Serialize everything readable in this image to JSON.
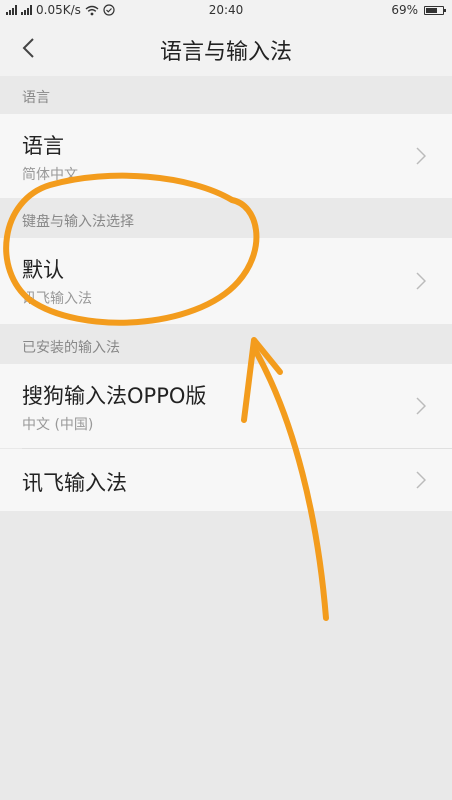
{
  "status_bar": {
    "network_speed": "0.05K/s",
    "time": "20:40",
    "battery": "69%",
    "battery_level": 0.69
  },
  "nav": {
    "title": "语言与输入法"
  },
  "sections": {
    "language": {
      "header": "语言",
      "item_title": "语言",
      "item_value": "简体中文"
    },
    "keyboard": {
      "header": "键盘与输入法选择",
      "item_title": "默认",
      "item_value": "讯飞输入法"
    },
    "installed": {
      "header": "已安装的输入法",
      "items": [
        {
          "title": "搜狗输入法OPPO版",
          "subtitle": "中文 (中国)"
        },
        {
          "title": "讯飞输入法",
          "subtitle": ""
        }
      ]
    }
  },
  "colors": {
    "annotation": "#f39c1d",
    "page_bg": "#e9e9e9",
    "row_bg": "#f7f7f7"
  }
}
